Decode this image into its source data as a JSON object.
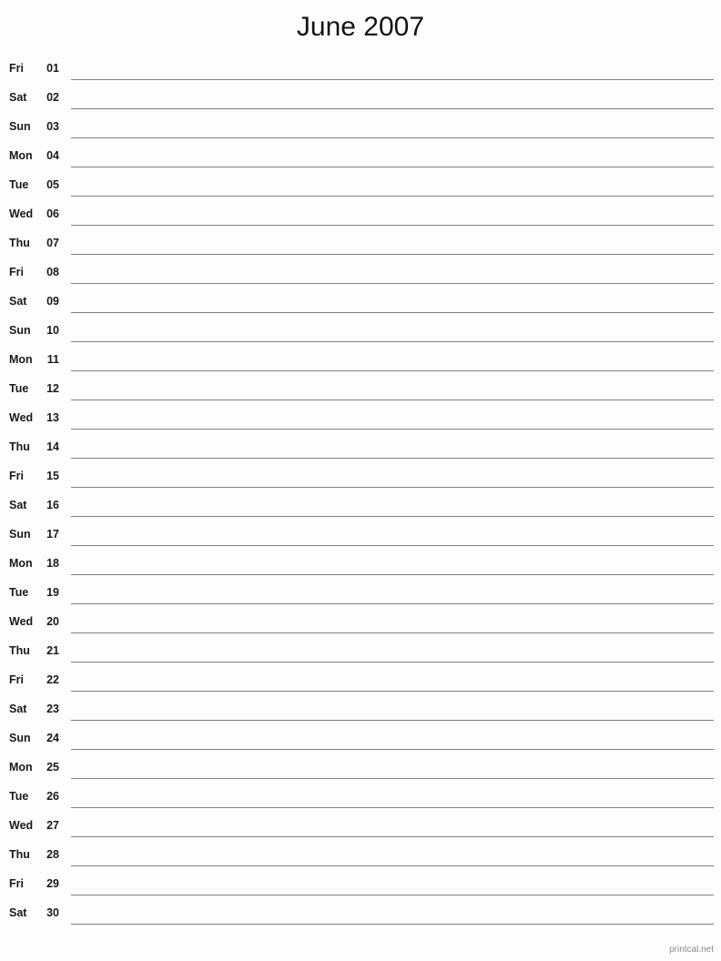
{
  "page": {
    "title": "June 2007",
    "footer_credit": "printcal.net",
    "line_color": "#808080",
    "text_color": "#1a1a1a",
    "background_color": "#fdfdfb",
    "footer_color": "#8a8a8a"
  },
  "days": [
    {
      "weekday": "Fri",
      "number": "01"
    },
    {
      "weekday": "Sat",
      "number": "02"
    },
    {
      "weekday": "Sun",
      "number": "03"
    },
    {
      "weekday": "Mon",
      "number": "04"
    },
    {
      "weekday": "Tue",
      "number": "05"
    },
    {
      "weekday": "Wed",
      "number": "06"
    },
    {
      "weekday": "Thu",
      "number": "07"
    },
    {
      "weekday": "Fri",
      "number": "08"
    },
    {
      "weekday": "Sat",
      "number": "09"
    },
    {
      "weekday": "Sun",
      "number": "10"
    },
    {
      "weekday": "Mon",
      "number": "11"
    },
    {
      "weekday": "Tue",
      "number": "12"
    },
    {
      "weekday": "Wed",
      "number": "13"
    },
    {
      "weekday": "Thu",
      "number": "14"
    },
    {
      "weekday": "Fri",
      "number": "15"
    },
    {
      "weekday": "Sat",
      "number": "16"
    },
    {
      "weekday": "Sun",
      "number": "17"
    },
    {
      "weekday": "Mon",
      "number": "18"
    },
    {
      "weekday": "Tue",
      "number": "19"
    },
    {
      "weekday": "Wed",
      "number": "20"
    },
    {
      "weekday": "Thu",
      "number": "21"
    },
    {
      "weekday": "Fri",
      "number": "22"
    },
    {
      "weekday": "Sat",
      "number": "23"
    },
    {
      "weekday": "Sun",
      "number": "24"
    },
    {
      "weekday": "Mon",
      "number": "25"
    },
    {
      "weekday": "Tue",
      "number": "26"
    },
    {
      "weekday": "Wed",
      "number": "27"
    },
    {
      "weekday": "Thu",
      "number": "28"
    },
    {
      "weekday": "Fri",
      "number": "29"
    },
    {
      "weekday": "Sat",
      "number": "30"
    }
  ]
}
